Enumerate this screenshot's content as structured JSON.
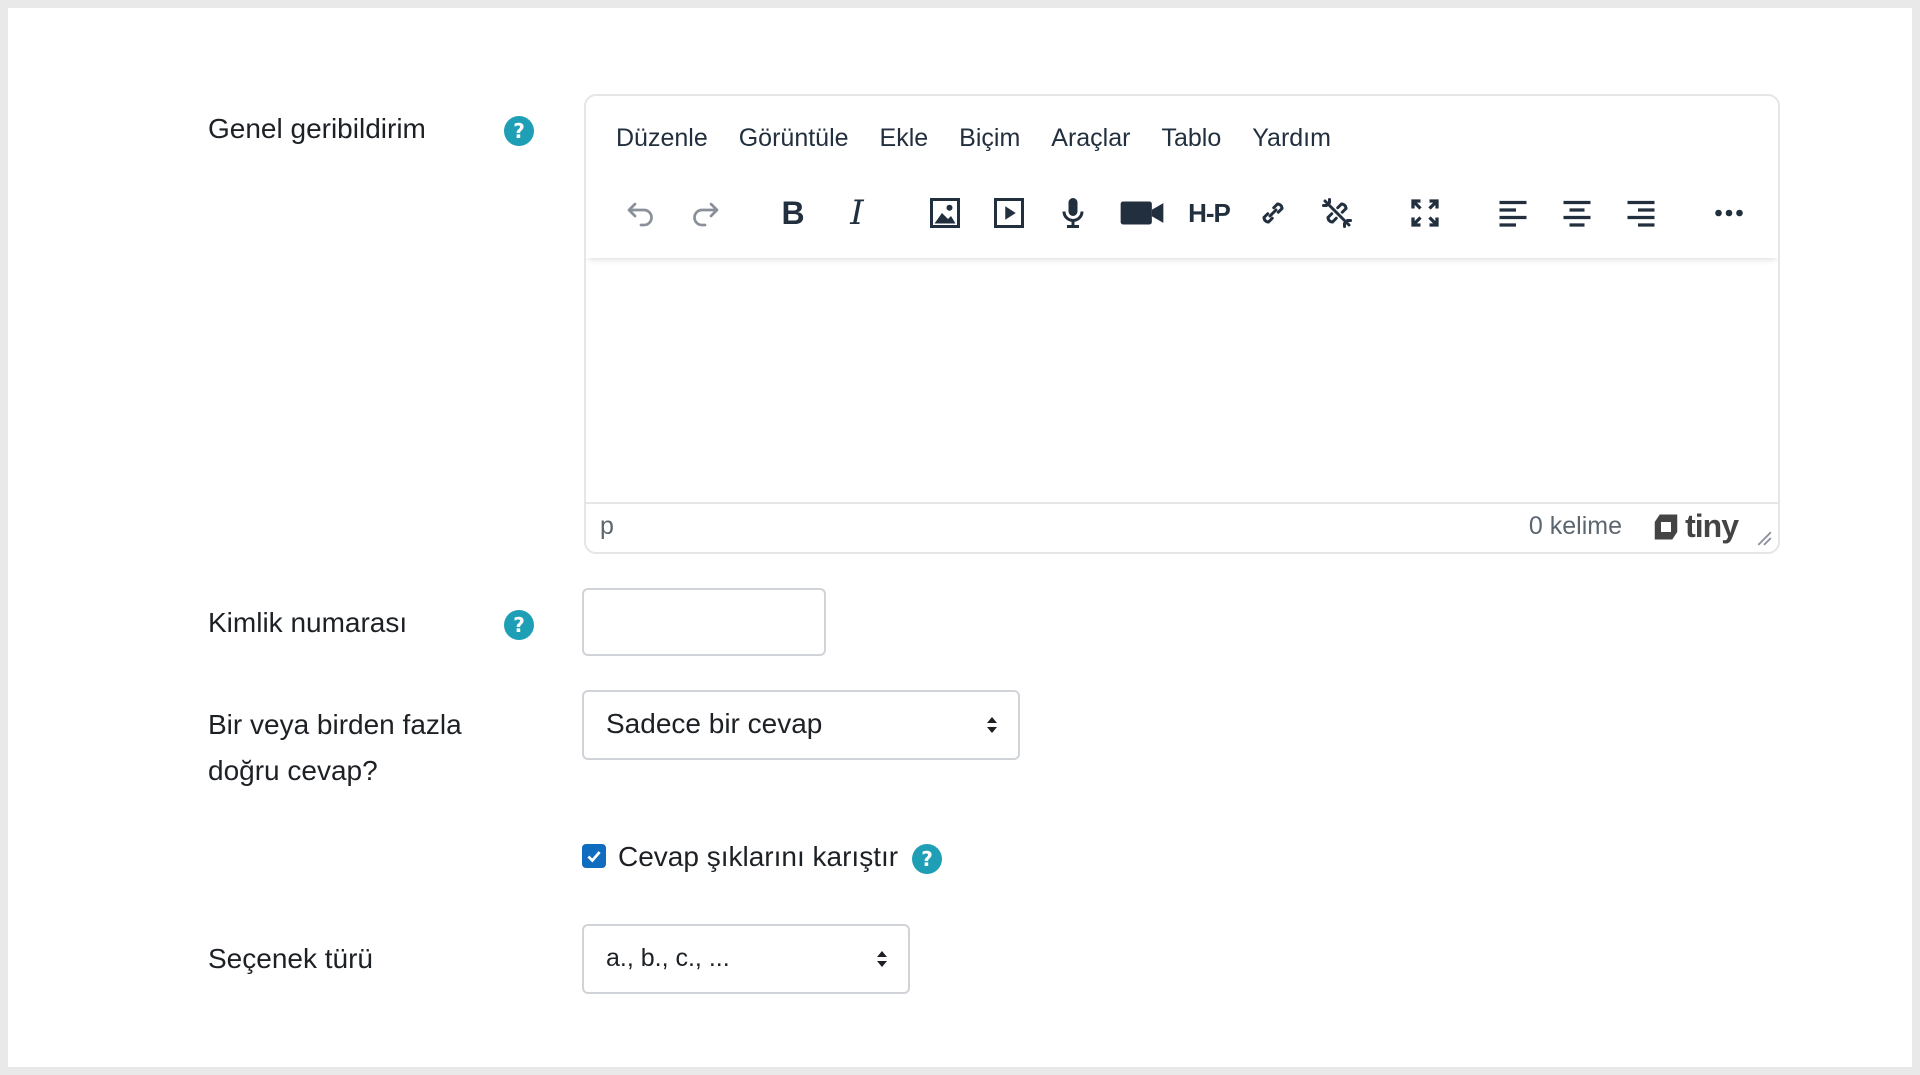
{
  "form": {
    "general_feedback": {
      "label": "Genel geribildirim",
      "help_icon": "?"
    },
    "editor": {
      "menu": [
        "Düzenle",
        "Görüntüle",
        "Ekle",
        "Biçim",
        "Araçlar",
        "Tablo",
        "Yardım"
      ],
      "toolbar": {
        "bold": "B",
        "italic": "I",
        "h5p": "H-P"
      },
      "status_path": "p",
      "word_count": "0 kelime",
      "branding": "tiny"
    },
    "id_number": {
      "label": "Kimlik numarası",
      "help_icon": "?",
      "value": ""
    },
    "single_answer": {
      "label_line1": "Bir veya birden fazla",
      "label_line2": "doğru cevap?",
      "selected": "Sadece bir cevap"
    },
    "shuffle": {
      "label": "Cevap şıklarını karıştır",
      "checked": true,
      "help_icon": "?"
    },
    "numbering": {
      "label": "Seçenek türü",
      "selected": "a., b., c., ..."
    }
  },
  "colors": {
    "help_badge": "#1f9fb5",
    "checkbox": "#0f6cbf",
    "toolbar_icon": "#222f3e"
  }
}
